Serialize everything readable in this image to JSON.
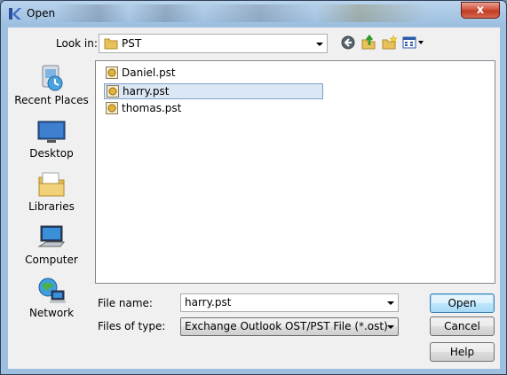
{
  "window": {
    "title": "Open",
    "close_label": "x"
  },
  "look_in": {
    "label": "Look in:",
    "value": "PST"
  },
  "toolbar": [
    "back-icon",
    "up-folder-icon",
    "new-folder-icon",
    "view-menu-icon"
  ],
  "places": [
    {
      "label": "Recent Places",
      "icon": "recent-places-icon"
    },
    {
      "label": "Desktop",
      "icon": "desktop-icon"
    },
    {
      "label": "Libraries",
      "icon": "libraries-icon"
    },
    {
      "label": "Computer",
      "icon": "computer-icon"
    },
    {
      "label": "Network",
      "icon": "network-icon"
    }
  ],
  "files": [
    {
      "name": "Daniel.pst",
      "selected": false
    },
    {
      "name": "harry.pst",
      "selected": true
    },
    {
      "name": "thomas.pst",
      "selected": false
    }
  ],
  "file_name": {
    "label": "File name:",
    "value": "harry.pst"
  },
  "file_type": {
    "label": "Files of type:",
    "value": "Exchange Outlook OST/PST File (*.ost)"
  },
  "buttons": {
    "open": "Open",
    "cancel": "Cancel",
    "help": "Help"
  }
}
